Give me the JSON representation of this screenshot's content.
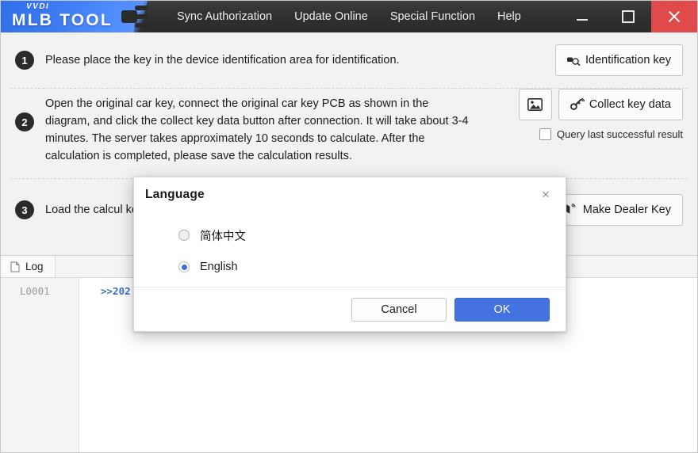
{
  "window": {
    "logo_small": "VVDI",
    "logo_main": "MLB TOOL",
    "menu": [
      {
        "label": "Sync Authorization"
      },
      {
        "label": "Update Online"
      },
      {
        "label": "Special Function"
      },
      {
        "label": "Help"
      }
    ],
    "controls": {
      "minimize": "minimize-button",
      "maximize": "maximize-button",
      "close": "close-button"
    }
  },
  "steps": [
    {
      "number": "1",
      "text": "Please place the key in the device identification area for identification.",
      "button": "Identification key"
    },
    {
      "number": "2",
      "text": "Open the original car key, connect the original car key PCB as shown in the diagram, and click the collect key data button after connection. It will take about 3-4 minutes. The server takes approximately 10 seconds to calculate. After the calculation is completed, please save the calculation results.",
      "button": "Collect key data",
      "checkbox_label": "Query last successful result",
      "checkbox_checked": false
    },
    {
      "number": "3",
      "text": "Load the calcul keys. Then use",
      "button": "Make Dealer Key"
    }
  ],
  "log": {
    "tab_label": "Log",
    "rows": [
      {
        "id": "L0001",
        "text": ">>202"
      }
    ]
  },
  "dialog": {
    "title": "Language",
    "close_label": "×",
    "options": [
      {
        "label": "简体中文",
        "selected": false
      },
      {
        "label": "English",
        "selected": true
      }
    ],
    "cancel_label": "Cancel",
    "ok_label": "OK"
  },
  "colors": {
    "brand_blue": "#3f7cf2",
    "accent_blue": "#4472e0",
    "close_red": "#e04a4a",
    "titlebar_dark": "#303030",
    "log_blue": "#3b6fc4"
  }
}
